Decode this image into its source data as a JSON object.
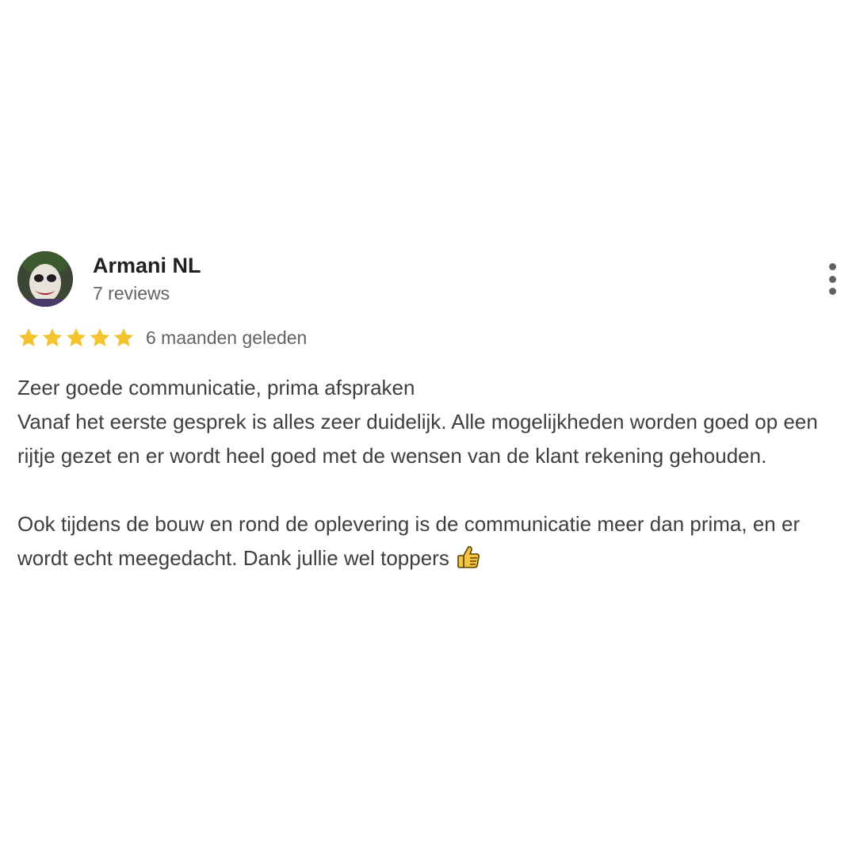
{
  "review": {
    "author_name": "Armani NL",
    "review_count": "7 reviews",
    "rating": 5,
    "rating_max": 5,
    "timestamp": "6 maanden geleden",
    "star_color": "#f4c430",
    "text": {
      "line1": "Zeer goede communicatie, prima afspraken",
      "line2": "Vanaf het eerste gesprek is alles zeer duidelijk. Alle mogelijkheden worden goed op een rijtje gezet en er wordt heel goed met de wensen van de klant rekening gehouden.",
      "paragraph2": "Ook tijdens de bouw en rond de oplevering is de communicatie meer dan prima, en er wordt echt meegedacht. Dank jullie wel toppers"
    },
    "emoji_icon": "thumbs-up-icon",
    "menu_icon": "more-vertical-icon"
  }
}
